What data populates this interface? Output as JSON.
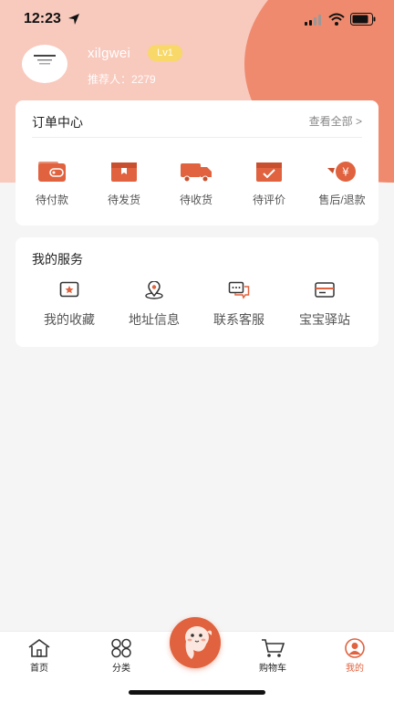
{
  "status_bar": {
    "time": "12:23"
  },
  "profile": {
    "username": "xilgwei",
    "level": "Lv1",
    "referrer_label": "推荐人：",
    "referrer_id": "2279"
  },
  "orders": {
    "title": "订单中心",
    "view_all": "查看全部 >",
    "items": [
      {
        "label": "待付款",
        "icon": "wallet-icon"
      },
      {
        "label": "待发货",
        "icon": "package-box-icon"
      },
      {
        "label": "待收货",
        "icon": "delivery-truck-icon"
      },
      {
        "label": "待评价",
        "icon": "review-checkbox-icon"
      },
      {
        "label": "售后/退款",
        "icon": "refund-yuan-icon",
        "symbol": "¥"
      }
    ]
  },
  "services": {
    "title": "我的服务",
    "items": [
      {
        "label": "我的收藏",
        "icon": "favorites-star-icon"
      },
      {
        "label": "地址信息",
        "icon": "location-pin-icon"
      },
      {
        "label": "联系客服",
        "icon": "chat-bubbles-icon"
      },
      {
        "label": "宝宝驿站",
        "icon": "card-station-icon"
      }
    ]
  },
  "tabbar": {
    "items": [
      {
        "label": "首页",
        "icon": "home-icon"
      },
      {
        "label": "分类",
        "icon": "category-grid-icon"
      },
      {
        "label": "",
        "icon": "mascot-center-icon"
      },
      {
        "label": "购物车",
        "icon": "shopping-cart-icon"
      },
      {
        "label": "我的",
        "icon": "profile-icon",
        "active": true
      }
    ]
  },
  "colors": {
    "accent": "#e0623e",
    "hero_bg": "#f8c9bd",
    "hero_blob": "#ef8a6e",
    "level_badge": "#f7d868"
  }
}
